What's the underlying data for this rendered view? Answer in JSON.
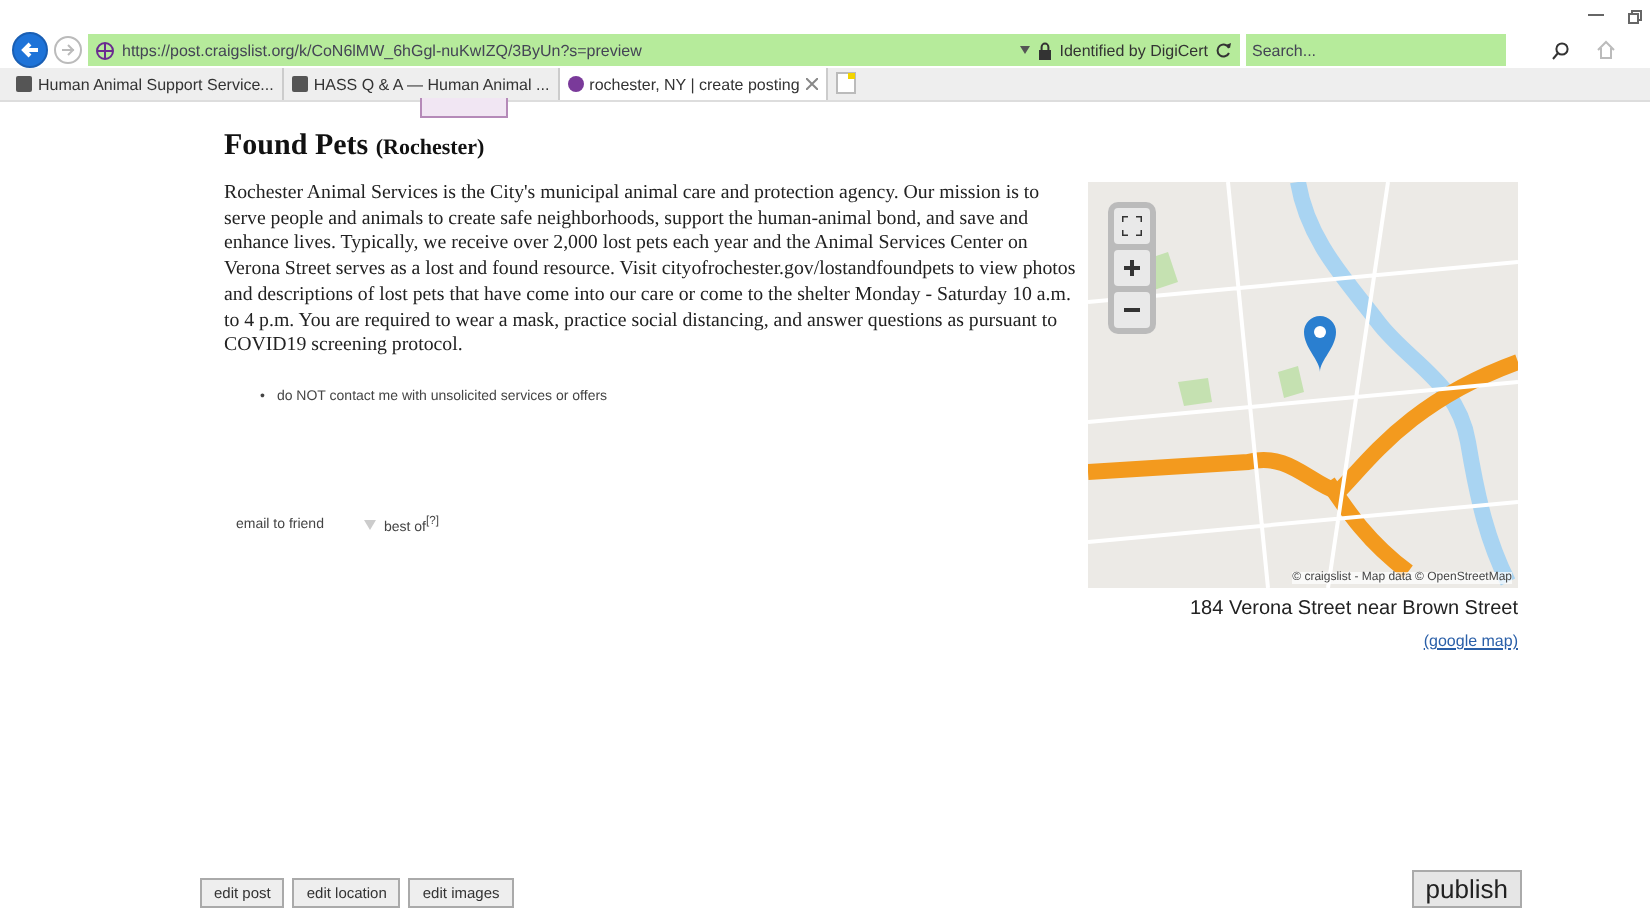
{
  "browser": {
    "url": "https://post.craigslist.org/k/CoN6lMW_6hGgl-nuKwIZQ/3ByUn?s=preview",
    "identity": "Identified by DigiCert",
    "search": {
      "placeholder": "Search..."
    },
    "tabs": [
      {
        "label": "Human Animal Support Service...",
        "selected": false
      },
      {
        "label": "HASS Q & A — Human Animal ...",
        "selected": false
      },
      {
        "label": "rochester, NY | create posting",
        "selected": true
      }
    ]
  },
  "post": {
    "title": "Found Pets",
    "location": "(Rochester)",
    "body": "Rochester Animal Services is the City's municipal animal care and protection agency. Our mission is to serve people and animals to create safe neighborhoods, support the human-animal bond, and save and enhance lives. Typically, we receive over 2,000 lost pets each year and the Animal Services Center on Verona Street serves as a lost and found resource. Visit cityofrochester.gov/lostandfoundpets to view photos and descriptions of lost pets that have come into our care or come to the shelter Monday - Saturday 10 a.m. to 4 p.m. You are required to wear a mask, practice social distancing, and answer questions as pursuant to COVID19 screening protocol.",
    "notices": [
      {
        "bullet": "•",
        "text": "do NOT contact me with unsolicited services or offers"
      }
    ],
    "map": {
      "attribution": "© craigslist - Map data © OpenStreetMap",
      "address": "184 Verona Street near Brown Street",
      "link": "(google map)"
    },
    "links": [
      {
        "kind": "plain",
        "label": "email to friend"
      },
      {
        "kind": "vote",
        "label": "best of$^{[?]}$"
      }
    ]
  },
  "actions": [
    "edit post",
    "edit location",
    "edit images"
  ],
  "publish": "publish"
}
